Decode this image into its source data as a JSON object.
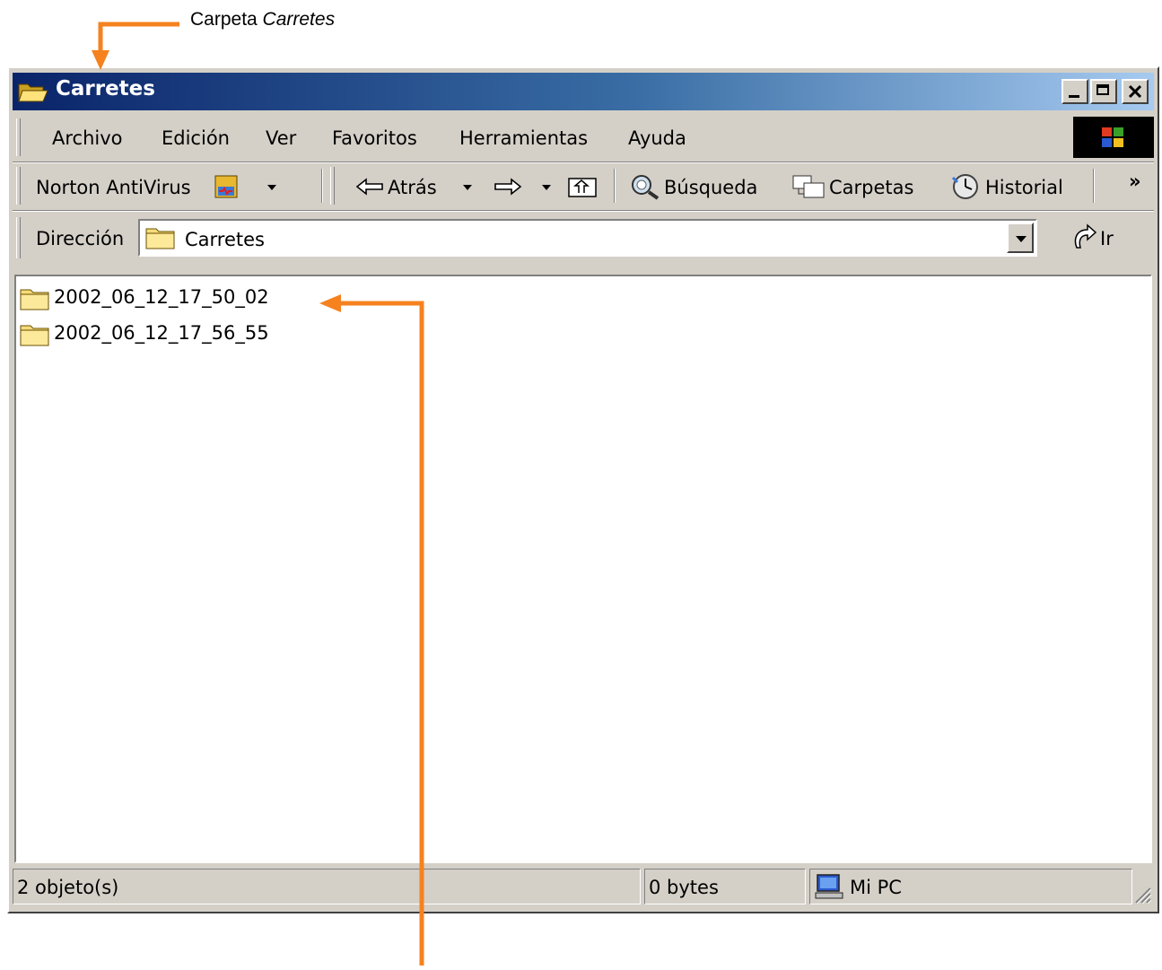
{
  "annotation": {
    "prefix": "Carpeta ",
    "emphasis": "Carretes",
    "arrow_color": "#f5821f"
  },
  "window": {
    "title": "Carretes"
  },
  "menu": [
    "Archivo",
    "Edición",
    "Ver",
    "Favoritos",
    "Herramientas",
    "Ayuda"
  ],
  "toolbar": {
    "norton": "Norton AntiVirus",
    "back": "Atrás",
    "search": "Búsqueda",
    "folders": "Carpetas",
    "history": "Historial",
    "more": "»"
  },
  "address": {
    "label": "Dirección",
    "value": "Carretes",
    "go": "Ir"
  },
  "files": [
    "2002_06_12_17_50_02",
    "2002_06_12_17_56_55"
  ],
  "status": {
    "objects": "2 objeto(s)",
    "size": "0 bytes",
    "zone": "Mi PC"
  }
}
